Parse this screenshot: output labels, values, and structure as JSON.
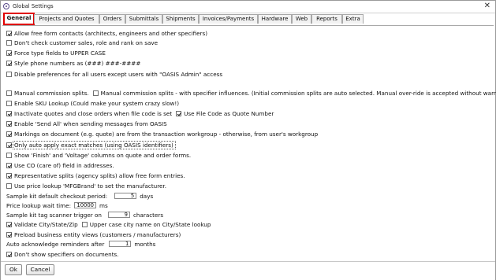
{
  "window": {
    "title": "Global Settings",
    "close_glyph": "✕",
    "icon": "app-logo-icon"
  },
  "tabs": [
    {
      "label": "General",
      "active": true
    },
    {
      "label": "Projects and Quotes",
      "active": false
    },
    {
      "label": "Orders",
      "active": false
    },
    {
      "label": "Submittals",
      "active": false
    },
    {
      "label": "Shipments",
      "active": false
    },
    {
      "label": "Invoices/Payments",
      "active": false
    },
    {
      "label": "Hardware",
      "active": false
    },
    {
      "label": "Web",
      "active": false
    },
    {
      "label": "Reports",
      "active": false
    },
    {
      "label": "Extra",
      "active": false
    }
  ],
  "settings": {
    "allow_free_form": {
      "label": "Allow free form contacts (architects, engineers and other specifiers)",
      "checked": true
    },
    "dont_check_customer_sales": {
      "label": "Don't check customer sales, role and rank on save",
      "checked": false
    },
    "force_upper_case": {
      "label": "Force type fields to UPPER CASE",
      "checked": true
    },
    "style_phone": {
      "label": "Style phone numbers as (###) ###-####",
      "checked": true
    },
    "disable_preferences": {
      "label": "Disable preferences for all users except users with \"OASIS Admin\" access",
      "checked": false
    },
    "manual_commission": {
      "label": "Manual commission splits.",
      "checked": false
    },
    "manual_commission_specifier": {
      "label": "Manual commission splits - with specifier influences. (Initial commission splits are auto selected.  Manual over-ride is accepted without warning)",
      "checked": false
    },
    "enable_sku_lookup": {
      "label": "Enable SKU Lookup (Could make your system crazy slow!)",
      "checked": false
    },
    "inactivate_quotes": {
      "label": "Inactivate quotes and close orders when file code is set",
      "checked": true
    },
    "use_file_code": {
      "label": "Use File Code as Quote Number",
      "checked": true
    },
    "enable_send_all": {
      "label": "Enable 'Send All' when sending messages from OASIS",
      "checked": true
    },
    "markings_on_document": {
      "label": "Markings on document (e.g. quote) are from the transaction workgroup - otherwise, from user's workgroup",
      "checked": true
    },
    "only_auto_apply": {
      "label": "Only auto apply exact matches (using OASIS identifiers)",
      "checked": true
    },
    "show_finish_voltage": {
      "label": "Show 'Finish' and 'Voltage' columns on quote and order forms.",
      "checked": false
    },
    "use_co_field": {
      "label": "Use CO (care of) field in addresses.",
      "checked": true
    },
    "representative_splits": {
      "label": "Representative splits (agency splits) allow free form entries.",
      "checked": true
    },
    "use_price_lookup": {
      "label": "Use price lookup 'MFGBrand' to set the manufacturer.",
      "checked": false
    },
    "sample_kit_checkout": {
      "label": "Sample kit default checkout period:",
      "value": "5",
      "unit": "days"
    },
    "price_lookup_wait": {
      "label": "Price lookup wait time:",
      "value": "10000",
      "unit": "ms"
    },
    "sample_kit_scanner": {
      "label": "Sample kit tag scanner trigger on",
      "value": "9",
      "unit": "characters"
    },
    "validate_city": {
      "label": "Validate City/State/Zip",
      "checked": true
    },
    "upper_case_city": {
      "label": "Upper case city name on City/State lookup",
      "checked": false
    },
    "preload_business": {
      "label": "Preload business entity views (customers / manufacturers)",
      "checked": true
    },
    "auto_acknowledge": {
      "label": "Auto acknowledge reminders after",
      "value": "1",
      "unit": "months"
    },
    "dont_show_specifiers": {
      "label": "Don't show specifiers on documents.",
      "checked": true
    }
  },
  "buttons": {
    "ok": "Ok",
    "cancel": "Cancel"
  }
}
